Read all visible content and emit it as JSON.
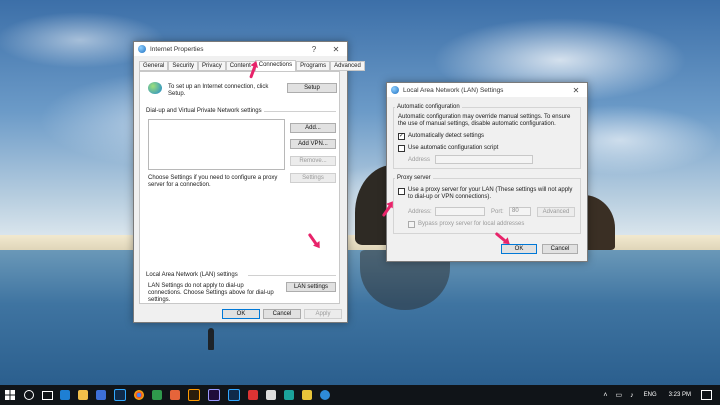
{
  "desktop": {
    "name": "Windows 10 desktop"
  },
  "internet_props": {
    "title": "Internet Properties",
    "help": "?",
    "close": "✕",
    "tabs": [
      "General",
      "Security",
      "Privacy",
      "Content",
      "Connections",
      "Programs",
      "Advanced"
    ],
    "active_tab": "Connections",
    "setup_text": "To set up an Internet connection, click Setup.",
    "setup_btn": "Setup",
    "dialup_label": "Dial-up and Virtual Private Network settings",
    "add_btn": "Add...",
    "add_vpn_btn": "Add VPN...",
    "remove_btn": "Remove...",
    "settings_btn": "Settings",
    "proxy_text": "Choose Settings if you need to configure a proxy server for a connection.",
    "lan_label": "Local Area Network (LAN) settings",
    "lan_text": "LAN Settings do not apply to dial-up connections. Choose Settings above for dial-up settings.",
    "lan_settings_btn": "LAN settings",
    "ok": "OK",
    "cancel": "Cancel",
    "apply": "Apply"
  },
  "lan_dialog": {
    "title": "Local Area Network (LAN) Settings",
    "close": "✕",
    "auto_config_label": "Automatic configuration",
    "auto_config_text": "Automatic configuration may override manual settings. To ensure the use of manual settings, disable automatic configuration.",
    "auto_detect": "Automatically detect settings",
    "auto_detect_checked": true,
    "use_script": "Use automatic configuration script",
    "use_script_checked": false,
    "address_label": "Address",
    "proxy_label": "Proxy server",
    "use_proxy": "Use a proxy server for your LAN (These settings will not apply to dial-up or VPN connections).",
    "use_proxy_checked": false,
    "proxy_address_label": "Address:",
    "port_label": "Port:",
    "port_value": "80",
    "advanced_btn": "Advanced",
    "bypass": "Bypass proxy server for local addresses",
    "ok": "OK",
    "cancel": "Cancel"
  },
  "taskbar": {
    "lang": "ENG",
    "time": "3:23 PM"
  },
  "colors": {
    "accent": "#0078d7",
    "annotation": "#e8236a"
  }
}
